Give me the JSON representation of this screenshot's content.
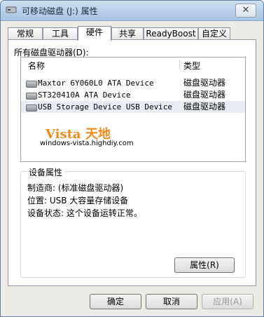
{
  "window": {
    "title": "可移动磁盘 (J:) 属性",
    "close_glyph": "✕"
  },
  "tabs": [
    {
      "label": "常规"
    },
    {
      "label": "工具"
    },
    {
      "label": "硬件",
      "active": true
    },
    {
      "label": "共享"
    },
    {
      "label": "ReadyBoost"
    },
    {
      "label": "自定义"
    }
  ],
  "drives_label": "所有磁盘驱动器(D):",
  "list": {
    "columns": {
      "name": "名称",
      "type": "类型"
    },
    "rows": [
      {
        "name": "Maxtor 6Y060L0 ATA Device",
        "type": "磁盘驱动器",
        "icon": "hard-drive-icon"
      },
      {
        "name": "ST320410A ATA Device",
        "type": "磁盘驱动器",
        "icon": "hard-drive-icon"
      },
      {
        "name": "USB Storage Device USB Device",
        "type": "磁盘驱动器",
        "icon": "usb-drive-icon",
        "selected": true
      }
    ]
  },
  "watermark": {
    "main": "Vista 天地",
    "sub": "windows-vista.highdiy.com"
  },
  "device_props": {
    "title": "设备属性",
    "manufacturer": "制造商: (标准磁盘驱动器)",
    "location": "位置: USB 大容量存储设备",
    "status": "设备状态: 这个设备运转正常。"
  },
  "buttons": {
    "properties": "属性(R)",
    "ok": "确定",
    "cancel": "取消",
    "apply": "应用(A)"
  },
  "colors": {
    "watermark": "#f08a1a",
    "title_bar": "#a9c4e3"
  }
}
